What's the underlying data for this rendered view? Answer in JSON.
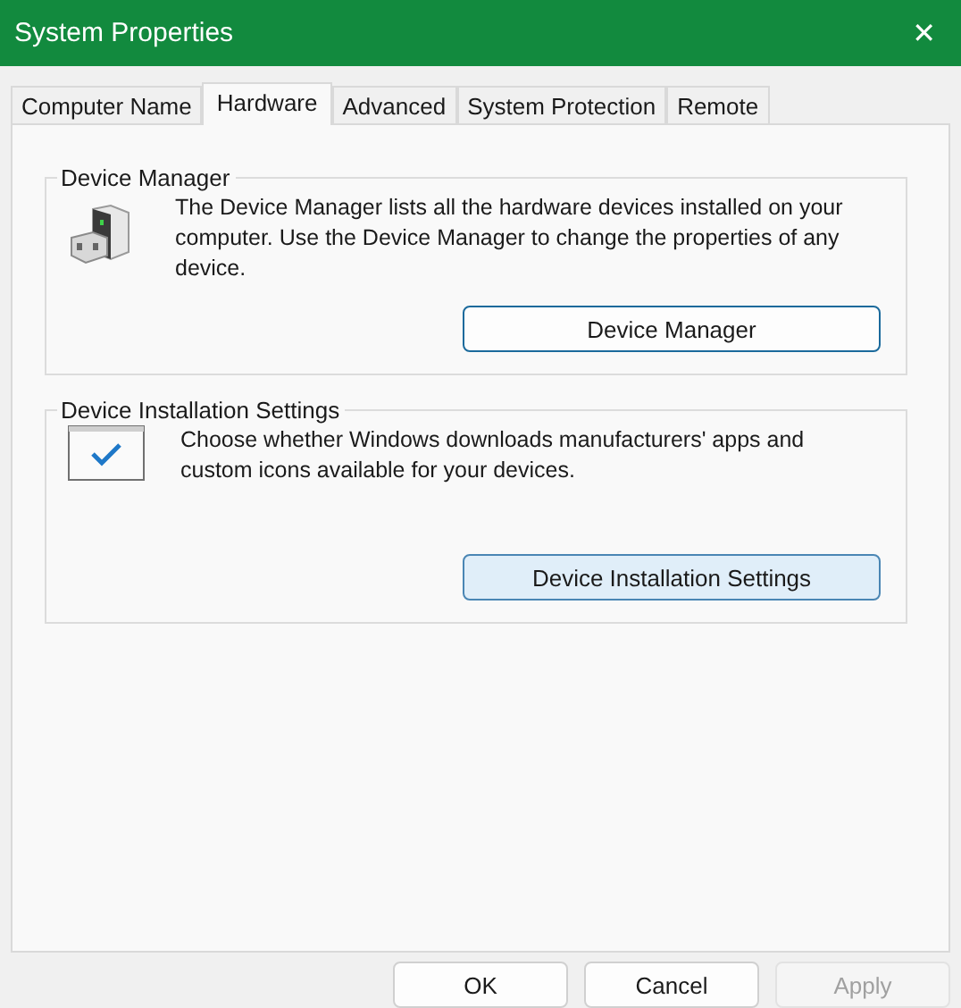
{
  "window": {
    "title": "System Properties",
    "close": "✕"
  },
  "tabs": [
    {
      "label": "Computer Name",
      "selected": false
    },
    {
      "label": "Hardware",
      "selected": true
    },
    {
      "label": "Advanced",
      "selected": false
    },
    {
      "label": "System Protection",
      "selected": false
    },
    {
      "label": "Remote",
      "selected": false
    }
  ],
  "groups": [
    {
      "kind": "device",
      "title": "Device Manager",
      "text": "The Device Manager lists all the hardware devices installed on your computer. Use the Device Manager to change the properties of any device.",
      "button": {
        "label": "Device Manager",
        "highlighted": false
      }
    },
    {
      "kind": "settings",
      "title": "Device Installation Settings",
      "text": "Choose whether Windows downloads manufacturers' apps and custom icons available for your devices.",
      "button": {
        "label": "Device Installation Settings",
        "highlighted": true
      }
    }
  ],
  "buttons": [
    {
      "label": "OK",
      "disabled": false
    },
    {
      "label": "Cancel",
      "disabled": false
    },
    {
      "label": "Apply",
      "disabled": true
    }
  ]
}
